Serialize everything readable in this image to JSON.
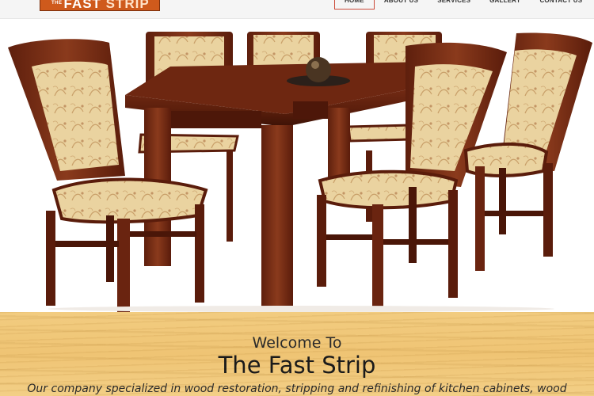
{
  "brand": {
    "logo_small": "THE",
    "logo_main": "FAST ",
    "logo_accent": "STRIP"
  },
  "nav": {
    "items": [
      {
        "label": "HOME",
        "active": true
      },
      {
        "label": "ABOUT US",
        "active": false
      },
      {
        "label": "SERVICES",
        "active": false
      },
      {
        "label": "GALLERY",
        "active": false
      },
      {
        "label": "CONTACT US",
        "active": false
      }
    ]
  },
  "hero": {
    "alt": "dining-table-with-chairs",
    "wood_color": "#7a2e16",
    "fabric_color": "#e8cf9c"
  },
  "welcome": {
    "line1": "Welcome To",
    "title": "The Fast Strip",
    "body": "Our company specialized in wood restoration, stripping and refinishing of kitchen cabinets, wood"
  },
  "colors": {
    "logo_bg": "#cf5a1c",
    "nav_active_border": "#cc4b3a",
    "band": "#f0c678"
  }
}
